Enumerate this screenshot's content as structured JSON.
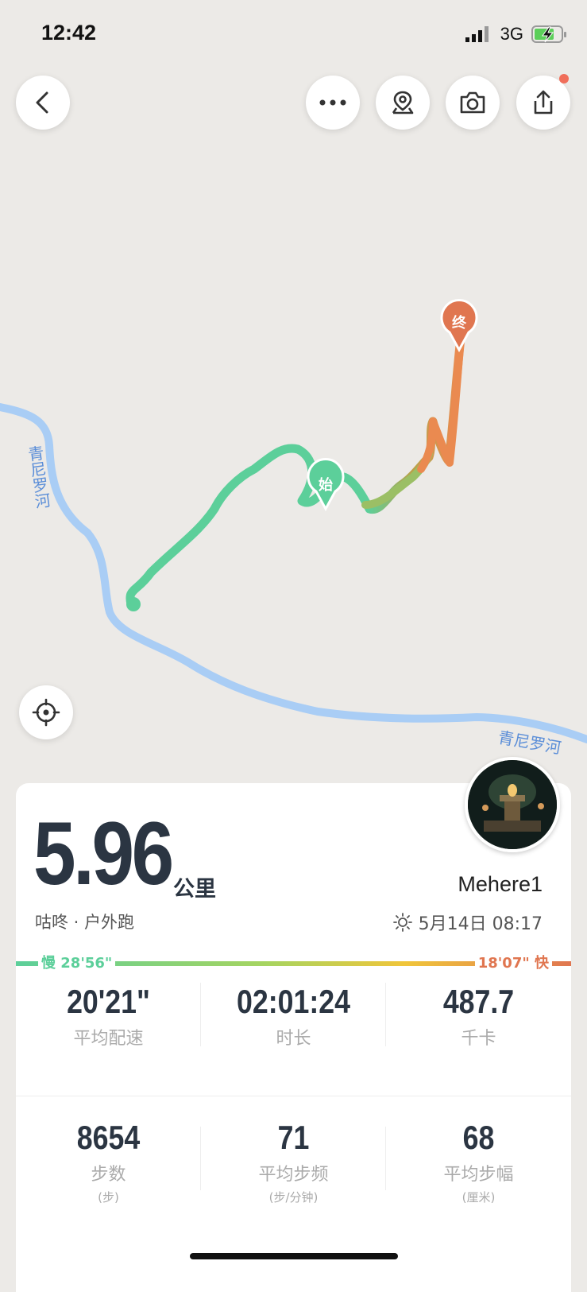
{
  "status_bar": {
    "time": "12:42",
    "network": "3G"
  },
  "map": {
    "river_labels": [
      "青尼罗河",
      "青尼罗河"
    ],
    "start_marker": "始",
    "end_marker": "终"
  },
  "summary": {
    "distance": "5.96",
    "unit": "公里",
    "sport": "咕咚 · 户外跑",
    "username": "Mehere1",
    "datetime": "5月14日 08:17",
    "pace_slow": "慢 28'56\"",
    "pace_fast": "18'07\" 快"
  },
  "stats": [
    {
      "value": "20'21\"",
      "label": "平均配速"
    },
    {
      "value": "02:01:24",
      "label": "时长"
    },
    {
      "value": "487.7",
      "label": "千卡"
    },
    {
      "value": "8654",
      "label": "步数",
      "unit": "(步)"
    },
    {
      "value": "71",
      "label": "平均步频",
      "unit": "(步/分钟)"
    },
    {
      "value": "68",
      "label": "平均步幅",
      "unit": "(厘米)"
    }
  ],
  "colors": {
    "slow": "#5ccf9a",
    "mid": "#f0c53a",
    "fast": "#e07650",
    "river": "#a9cdf5"
  },
  "icons": [
    "back-icon",
    "more-icon",
    "location-pin-icon",
    "camera-icon",
    "share-icon",
    "locate-icon",
    "sun-icon"
  ]
}
